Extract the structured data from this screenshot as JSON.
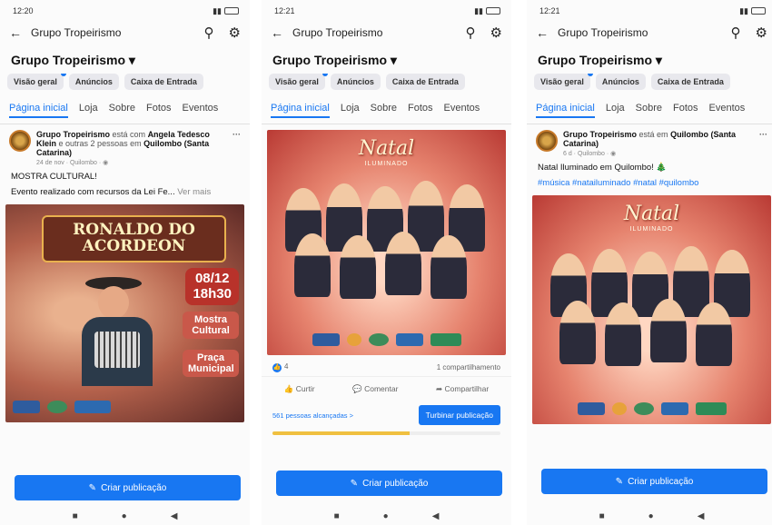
{
  "shared": {
    "group_name": "Grupo Tropeirismo",
    "group_name_dropdown": "Grupo Tropeirismo ▾",
    "chips": [
      "Visão geral",
      "Anúncios",
      "Caixa de Entrada"
    ],
    "tabs": [
      "Página inicial",
      "Loja",
      "Sobre",
      "Fotos",
      "Eventos"
    ],
    "create_post": "Criar publicação",
    "icons": [
      "back-arrow-icon",
      "search-icon",
      "gear-icon",
      "more-icon",
      "globe-icon",
      "like-icon",
      "comment-icon",
      "share-icon",
      "pencil-icon"
    ]
  },
  "screens": [
    {
      "time": "12:20",
      "post": {
        "author": "Grupo Tropeirismo",
        "with_text": "está com",
        "tagged": "Angela Tedesco Klein",
        "and_others": "e outras 2 pessoas",
        "in_text": "em",
        "place": "Quilombo (Santa Catarina)",
        "meta": "24 de nov · Quilombo · ◉",
        "title_text": "MOSTRA CULTURAL!",
        "body_text": "Evento realizado com recursos da Lei Fe...",
        "see_more": "Ver mais",
        "poster": {
          "title": "RONALDO DO ACORDEON",
          "date": "08/12",
          "hour": "18h30",
          "box1": "Mostra Cultural",
          "box2": "Praça Municipal"
        }
      }
    },
    {
      "time": "12:21",
      "post": {
        "poster_title": "Natal",
        "poster_sub": "ILUMINADO",
        "reactions": "4",
        "shares": "1 compartilhamento",
        "actions": [
          "Curtir",
          "Comentar",
          "Compartilhar"
        ],
        "reach": "561 pessoas alcançadas >",
        "boost": "Turbinar publicação",
        "reach_progress": 0.6
      }
    },
    {
      "time": "12:21",
      "post": {
        "author": "Grupo Tropeirismo",
        "in_text": "está em",
        "place": "Quilombo (Santa Catarina)",
        "meta": "6 d · Quilombo · ◉",
        "text": "Natal Iluminado em Quilombo! 🎄",
        "hashtags": "#música #natailuminado #natal #quilombo",
        "poster_title": "Natal",
        "poster_sub": "ILUMINADO"
      }
    }
  ]
}
